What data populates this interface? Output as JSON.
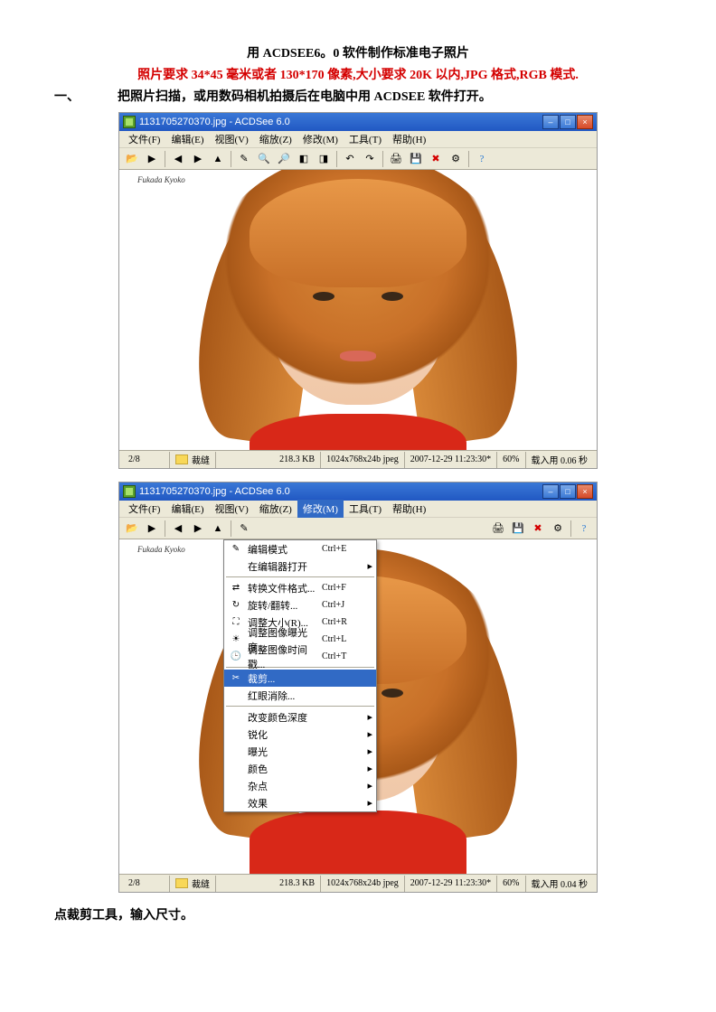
{
  "doc": {
    "title": "用 ACDSEE6。0 软件制作标准电子照片",
    "requirement": "照片要求 34*45 毫米或者 130*170 像素,大小要求 20K 以内,JPG 格式,RGB 模式.",
    "step1_num": "一、",
    "step1_txt": "把照片扫描，或用数码相机拍摄后在电脑中用 ACDSEE 软件打开。",
    "footer": "点裁剪工具，输入尺寸。"
  },
  "win": {
    "title": "1131705270370.jpg - ACDSee 6.0",
    "watermark": "Fukada Kyoko"
  },
  "menu": {
    "file": "文件(F)",
    "edit": "编辑(E)",
    "view": "视图(V)",
    "zoom": "缩放(Z)",
    "modify": "修改(M)",
    "tools": "工具(T)",
    "help": "帮助(H)"
  },
  "status": {
    "pos": "2/8",
    "folder": "裁缝",
    "size": "218.3 KB",
    "dim": "1024x768x24b jpeg",
    "date": "2007-12-29 11:23:30*",
    "zoom": "60%",
    "load": "载入用 0.06 秒",
    "load2": "载入用 0.04 秒"
  },
  "dropdown": {
    "i1": "编辑模式",
    "i1s": "Ctrl+E",
    "i2": "在编辑器打开",
    "i3": "转换文件格式...",
    "i3s": "Ctrl+F",
    "i4": "旋转/翻转...",
    "i4s": "Ctrl+J",
    "i5": "调整大小(R)...",
    "i5s": "Ctrl+R",
    "i6": "调整图像曝光度...",
    "i6s": "Ctrl+L",
    "i7": "调整图像时间戳...",
    "i7s": "Ctrl+T",
    "i8": "裁剪...",
    "i9": "红眼消除...",
    "i10": "改变颜色深度",
    "i11": "锐化",
    "i12": "曝光",
    "i13": "颜色",
    "i14": "杂点",
    "i15": "效果"
  }
}
